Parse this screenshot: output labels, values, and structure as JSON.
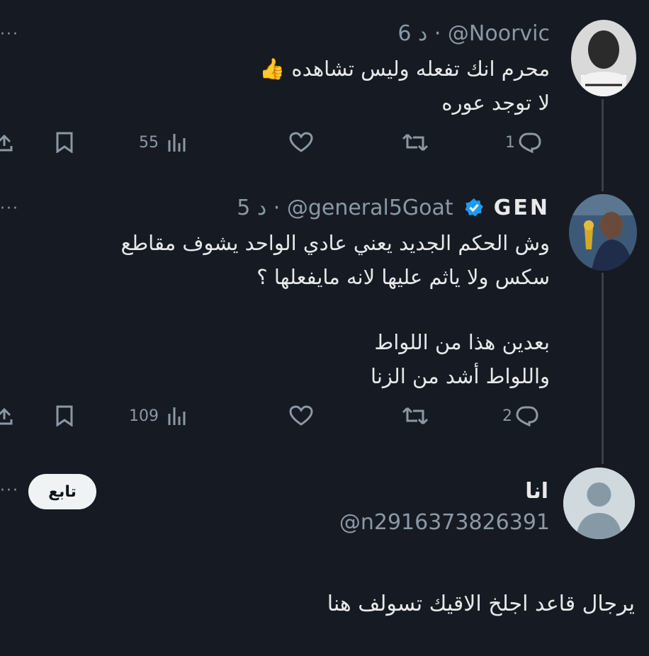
{
  "tweets": [
    {
      "handle": "@Noorvic",
      "time": "6 د",
      "lines": [
        "محرم انك تفعله وليس تشاهده 👍",
        "لا توجد عوره"
      ],
      "views": "55",
      "replies": "1"
    },
    {
      "display_name": "GEN",
      "handle": "@general5Goat",
      "time": "5 د",
      "lines": [
        "وش الحكم الجديد يعني عادي الواحد يشوف مقاطع",
        "سكس ولا ياثم عليها لانه مايفعلها ؟",
        "بعدين هذا من اللواط",
        "واللواط أشد من الزنا"
      ],
      "views": "109",
      "replies": "2"
    }
  ],
  "reply_box": {
    "name": "انا",
    "handle": "@n2916373826391",
    "follow_label": "تابع",
    "text": "يرجال قاعد اجلخ الاقيك تسولف هنا"
  },
  "more_glyph": "···",
  "colors": {
    "background": "#161a22",
    "muted": "#8b98a5",
    "text": "#e7e9ea",
    "verified": "#1d9bf0"
  }
}
